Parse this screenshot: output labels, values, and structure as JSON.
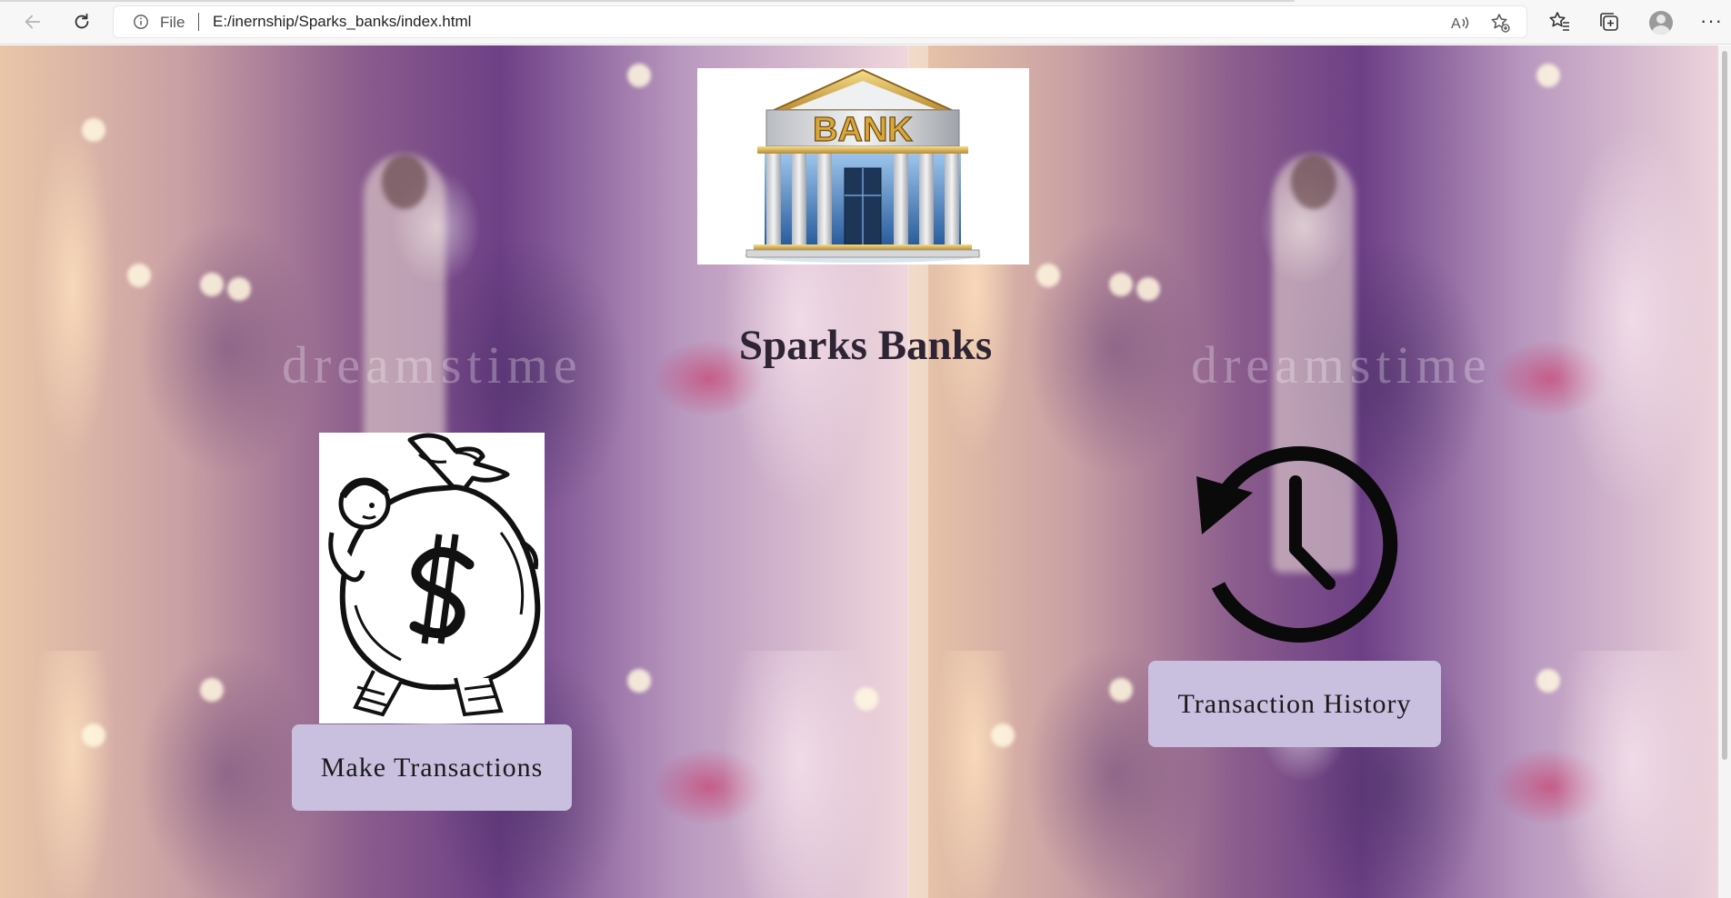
{
  "browser": {
    "file_label": "File",
    "url": "E:/inernship/Sparks_banks/index.html"
  },
  "page": {
    "logo_text": "BANK",
    "title": "Sparks Banks",
    "make_transactions_label": "Make Transactions",
    "transaction_history_label": "Transaction History",
    "watermark_text": "dreamstime",
    "button_color": "#c9c0e0",
    "title_color": "#2e2434"
  }
}
